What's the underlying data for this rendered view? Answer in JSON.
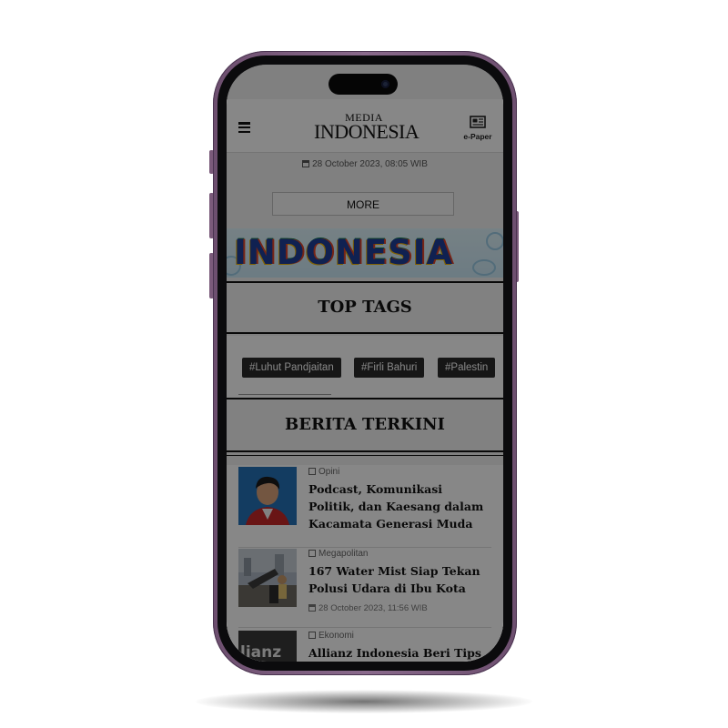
{
  "header": {
    "logo_top": "MEDIA",
    "logo_bottom": "INDONESIA",
    "epaper_label": "e-Paper"
  },
  "page": {
    "date": "28 October 2023, 08:05 WIB",
    "more_label": "MORE"
  },
  "banner": {
    "text": "INDONESIA"
  },
  "top_tags": {
    "title": "TOP TAGS",
    "tags": [
      "#Luhut Pandjaitan",
      "#Firli Bahuri",
      "#Palestin"
    ]
  },
  "latest": {
    "title": "BERITA TERKINI",
    "items": [
      {
        "category": "Opini",
        "title": "Podcast, Komunikasi Politik, dan Kaesang dalam Kacamata Generasi Muda"
      },
      {
        "category": "Megapolitan",
        "title": "167 Water Mist Siap Tekan Polusi Udara di Ibu Kota",
        "date": "28 October 2023, 11:56 WIB"
      },
      {
        "category": "Ekonomi",
        "title": "Allianz Indonesia Beri Tips",
        "thumb_text": "lianz"
      }
    ]
  },
  "colors": {
    "frame": "#7a5a7a",
    "overlay": "#000000",
    "tag_bg": "#2b2b2b"
  }
}
